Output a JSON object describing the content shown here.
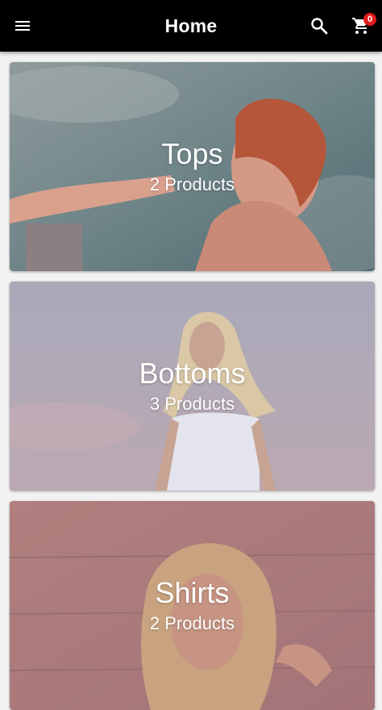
{
  "appbar": {
    "title": "Home",
    "menu_icon": "hamburger-menu-icon",
    "search_icon": "search-icon",
    "cart_icon": "shopping-cart-icon",
    "cart_count": "0",
    "background": "#000000",
    "badge_color": "#e21b1b"
  },
  "categories": [
    {
      "name": "Tops",
      "count": "2 Products"
    },
    {
      "name": "Bottoms",
      "count": "3 Products"
    },
    {
      "name": "Shirts",
      "count": "2 Products"
    }
  ]
}
